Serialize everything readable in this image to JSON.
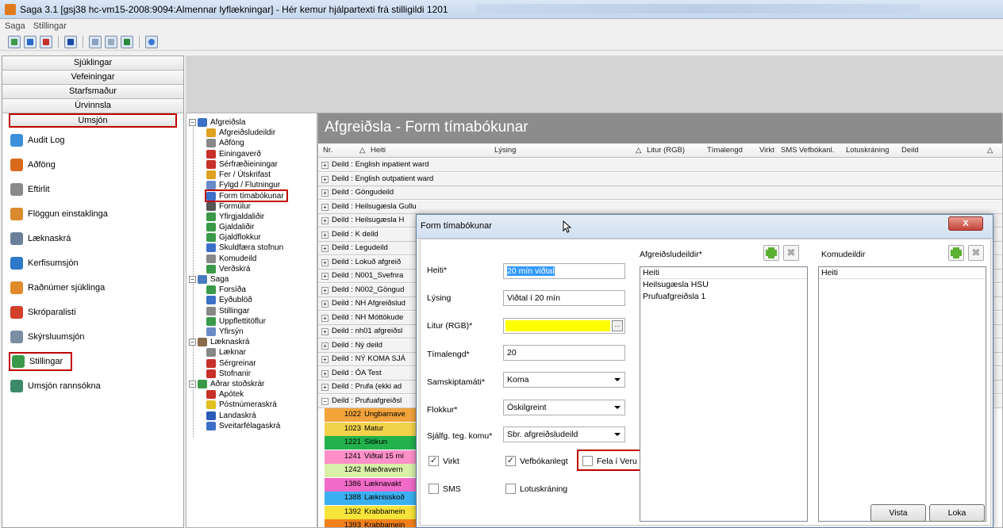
{
  "window": {
    "title": "Saga 3.1  [gsj38 hc-vm15-2008:9094:Almennar lyflækningar] - Hér kemur hjálpartexti frá stilligildi 1201"
  },
  "menu": [
    "Saga",
    "Stillingar"
  ],
  "nav": {
    "headers": [
      "Sjúklingar",
      "Vefeiningar",
      "Starfsmaður",
      "Úrvinnsla",
      "Umsjón"
    ],
    "items": [
      {
        "label": "Audit Log",
        "color": "#3c8fd8"
      },
      {
        "label": "Aðföng",
        "color": "#d96a1c"
      },
      {
        "label": "Eftirlit",
        "color": "#8a8a8a"
      },
      {
        "label": "Flöggun einstaklinga",
        "color": "#d98a2c"
      },
      {
        "label": "Læknaskrá",
        "color": "#6a7f98"
      },
      {
        "label": "Kerfisumsjón",
        "color": "#2d78c8"
      },
      {
        "label": "Raðnúmer sjúklinga",
        "color": "#e08a2a"
      },
      {
        "label": "Skróparalisti",
        "color": "#d2402c"
      },
      {
        "label": "Skýrsluumsjón",
        "color": "#7c8ea4"
      },
      {
        "label": "Stillingar",
        "color": "#3a9a4a"
      },
      {
        "label": "Umsjón rannsókna",
        "color": "#3c8a6a"
      }
    ]
  },
  "tree": [
    {
      "label": "Afgreiðsla",
      "level": 0,
      "color": "#3c6fc8"
    },
    {
      "label": "Afgreiðsludeildir",
      "level": 1,
      "color": "#e0a020"
    },
    {
      "label": "Aðföng",
      "level": 1,
      "color": "#888888"
    },
    {
      "label": "Einingaverð",
      "level": 1,
      "color": "#c8302a"
    },
    {
      "label": "Sérfræðieiningar",
      "level": 1,
      "color": "#c8302a"
    },
    {
      "label": "Fer / Útskrifast",
      "level": 1,
      "color": "#e0a020"
    },
    {
      "label": "Fylgd / Flutningur",
      "level": 1,
      "color": "#6a8ac8"
    },
    {
      "label": "Form tímabókunar",
      "level": 1,
      "color": "#3c6fc8"
    },
    {
      "label": "Formúlur",
      "level": 1,
      "color": "#555555"
    },
    {
      "label": "Yfirgjaldaliðir",
      "level": 1,
      "color": "#3a9a4a"
    },
    {
      "label": "Gjaldaliðir",
      "level": 1,
      "color": "#3a9a4a"
    },
    {
      "label": "Gjaldflokkur",
      "level": 1,
      "color": "#3a9a4a"
    },
    {
      "label": "Skuldfæra stofnun",
      "level": 1,
      "color": "#3c6fc8"
    },
    {
      "label": "Komudeild",
      "level": 1,
      "color": "#888888"
    },
    {
      "label": "Verðskrá",
      "level": 1,
      "color": "#3a9a4a"
    },
    {
      "label": "Saga",
      "level": 0,
      "color": "#4a7ac0"
    },
    {
      "label": "Forsíða",
      "level": 1,
      "color": "#3a9a4a"
    },
    {
      "label": "Eyðublöð",
      "level": 1,
      "color": "#3c6fc8"
    },
    {
      "label": "Stillingar",
      "level": 1,
      "color": "#888888"
    },
    {
      "label": "Uppflettitöflur",
      "level": 1,
      "color": "#3a9a4a"
    },
    {
      "label": "Yfirsýn",
      "level": 1,
      "color": "#6a8ac8"
    },
    {
      "label": "Læknaskrá",
      "level": 0,
      "color": "#8a6a4a"
    },
    {
      "label": "Læknar",
      "level": 1,
      "color": "#888888"
    },
    {
      "label": "Sérgreinar",
      "level": 1,
      "color": "#c8302a"
    },
    {
      "label": "Stofnanir",
      "level": 1,
      "color": "#c8302a"
    },
    {
      "label": "Aðrar stoðskrár",
      "level": 0,
      "color": "#3a9a4a"
    },
    {
      "label": "Apótek",
      "level": 1,
      "color": "#c8302a"
    },
    {
      "label": "Póstnúmeraskrá",
      "level": 1,
      "color": "#e0c020"
    },
    {
      "label": "Landaskrá",
      "level": 1,
      "color": "#2a5ab8"
    },
    {
      "label": "Sveitarfélagaskrá",
      "level": 1,
      "color": "#3c6fc8"
    }
  ],
  "grid": {
    "title": "Afgreiðsla - Form tímabókunar",
    "columns": [
      "Nr.",
      "Heiti",
      "Lýsing",
      "Litur (RGB)",
      "Tímalengd",
      "Virkt",
      "SMS",
      "Vefbókanl.",
      "Lotuskráning",
      "Deild"
    ],
    "groups": [
      "Deild : English inpatient ward",
      "Deild : English outpatient ward",
      "Deild : Göngudeild",
      "Deild : Heilsugæsla Gullu",
      "Deild : Heilsugæsla H",
      "Deild : K deild",
      "Deild : Legudeild",
      "Deild : Lokuð afgreið",
      "Deild : N001_Svefnra",
      "Deild : N002_Göngud",
      "Deild : NH Afgreiðslud",
      "Deild : NH Móttökude",
      "Deild : nh01 afgreiðsl",
      "Deild : Ný deild",
      "Deild : NÝ KOMA SJÁ",
      "Deild : ÓA Test",
      "Deild : Prufa (ekki ad",
      "Deild : Prufuafgreiðsl"
    ],
    "child_rows": [
      {
        "nr": "1022",
        "heiti": "Ungbarnave",
        "color": "#f2a33a"
      },
      {
        "nr": "1023",
        "heiti": "Matur",
        "color": "#f2d24a"
      },
      {
        "nr": "1221",
        "heiti": "Slökun",
        "color": "#22b14c"
      },
      {
        "nr": "1241",
        "heiti": "Viðtal 15 mí",
        "color": "#ff8fc8"
      },
      {
        "nr": "1242",
        "heiti": "Mæðravern",
        "color": "#d8f0a8"
      },
      {
        "nr": "1386",
        "heiti": "Læknavakt",
        "color": "#f26ac8"
      },
      {
        "nr": "1388",
        "heiti": "Læknisskoð",
        "color": "#3ab0f0"
      },
      {
        "nr": "1392",
        "heiti": "Krabbamein",
        "color": "#f7e43a"
      },
      {
        "nr": "1393",
        "heiti": "Krabbamein",
        "color": "#f2801a"
      }
    ]
  },
  "dialog": {
    "title": "Form tímabókunar",
    "close": "X",
    "fields": {
      "heiti_label": "Heiti*",
      "heiti_value": "20 mín viðtal",
      "lysing_label": "Lýsing",
      "lysing_value": "Viðtal í 20 mín",
      "litur_label": "Litur (RGB)*",
      "litur_value": "#ffff00",
      "litur_btn": "...",
      "timalengd_label": "Tímalengd*",
      "timalengd_value": "20",
      "samskipta_label": "Samskiptamáti*",
      "samskipta_value": "Koma",
      "flokkur_label": "Flokkur*",
      "flokkur_value": "Óskilgreint",
      "sjalfg_label": "Sjálfg. teg. komu*",
      "sjalfg_value": "Sbr. afgreiðsludeild"
    },
    "checks": [
      {
        "label": "Virkt",
        "checked": true
      },
      {
        "label": "Vefbókanlegt",
        "checked": true
      },
      {
        "label": "Fela í Veru",
        "checked": false
      },
      {
        "label": "SMS",
        "checked": false
      },
      {
        "label": "Lotuskráning",
        "checked": false
      }
    ],
    "afgreidsludeildir": {
      "label": "Afgreiðsludeildir*",
      "header": "Heiti",
      "items": [
        "Heilsugæsla HSU",
        "Prufuafgreiðsla 1"
      ]
    },
    "komudeildir": {
      "label": "Komudeildir",
      "header": "Heiti",
      "items": []
    },
    "buttons": {
      "vista": "Vista",
      "loka": "Loka"
    }
  }
}
